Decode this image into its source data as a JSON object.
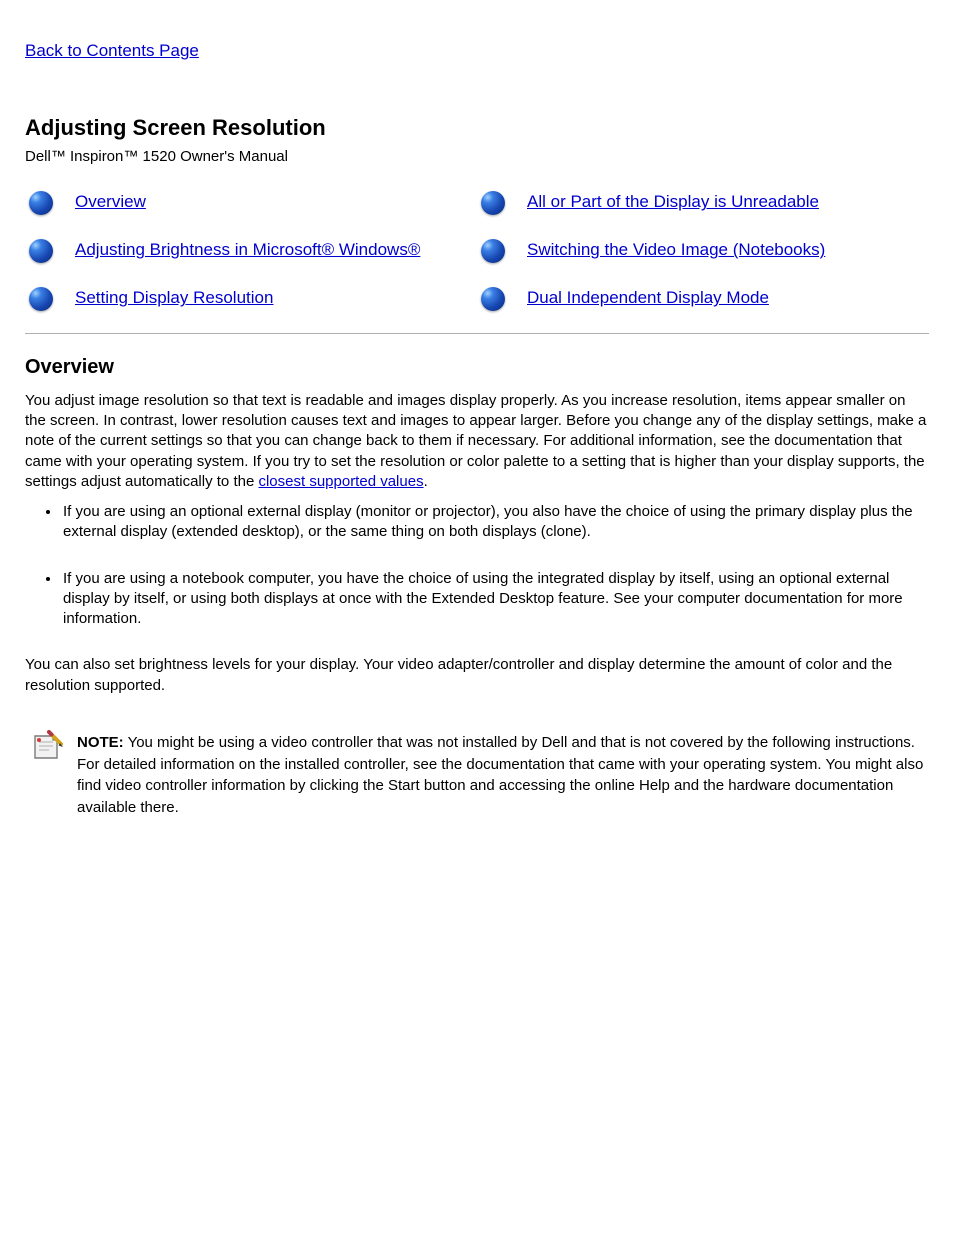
{
  "back_link": "Back to Contents Page",
  "title": "Adjusting Screen Resolution",
  "subtitle": "Dell™ Inspiron™ 1520 Owner's Manual",
  "toc_links": {
    "r0c0": "Overview",
    "r0c1": "All or Part of the Display is Unreadable",
    "r1c0": "Adjusting Brightness in Microsoft® Windows®",
    "r1c1": "Switching the Video Image (Notebooks)",
    "r2c0": "Setting Display Resolution",
    "r2c1": "Dual Independent Display Mode"
  },
  "section_heading": "Overview",
  "intro": {
    "before": "You adjust image resolution so that text is readable and images display properly. As you increase resolution, items appear smaller on the screen. In contrast, lower resolution causes text and images to appear larger. Before you change any of the display settings, make a note of the current settings so that you can change back to them if necessary. For additional information, see the documentation that came with your operating system. If you try to set the resolution or color palette to a setting that is higher than your display supports, the settings adjust automatically to the ",
    "link_text": "closest supported values",
    "after": "."
  },
  "bullets": {
    "b1": "If you are using an optional external display (monitor or projector), you also have the choice of using the primary display plus the external display (extended desktop), or the same thing on both displays (clone).",
    "b2": "If you are using a notebook computer, you have the choice of using the integrated display by itself, using an optional external display by itself, or using both displays at once with the Extended Desktop feature. See your computer documentation for more information."
  },
  "closing": "You can also set brightness levels for your display. Your video adapter/controller and display determine the amount of color and the resolution supported.",
  "note": {
    "prefix": "NOTE:",
    "body": "You might be using a video controller that was not installed by Dell and that is not covered by the following instructions. For detailed information on the installed controller, see the documentation that came with your operating system. You might also find video controller information by clicking the Start button and accessing the online Help and the hardware documentation available there."
  }
}
